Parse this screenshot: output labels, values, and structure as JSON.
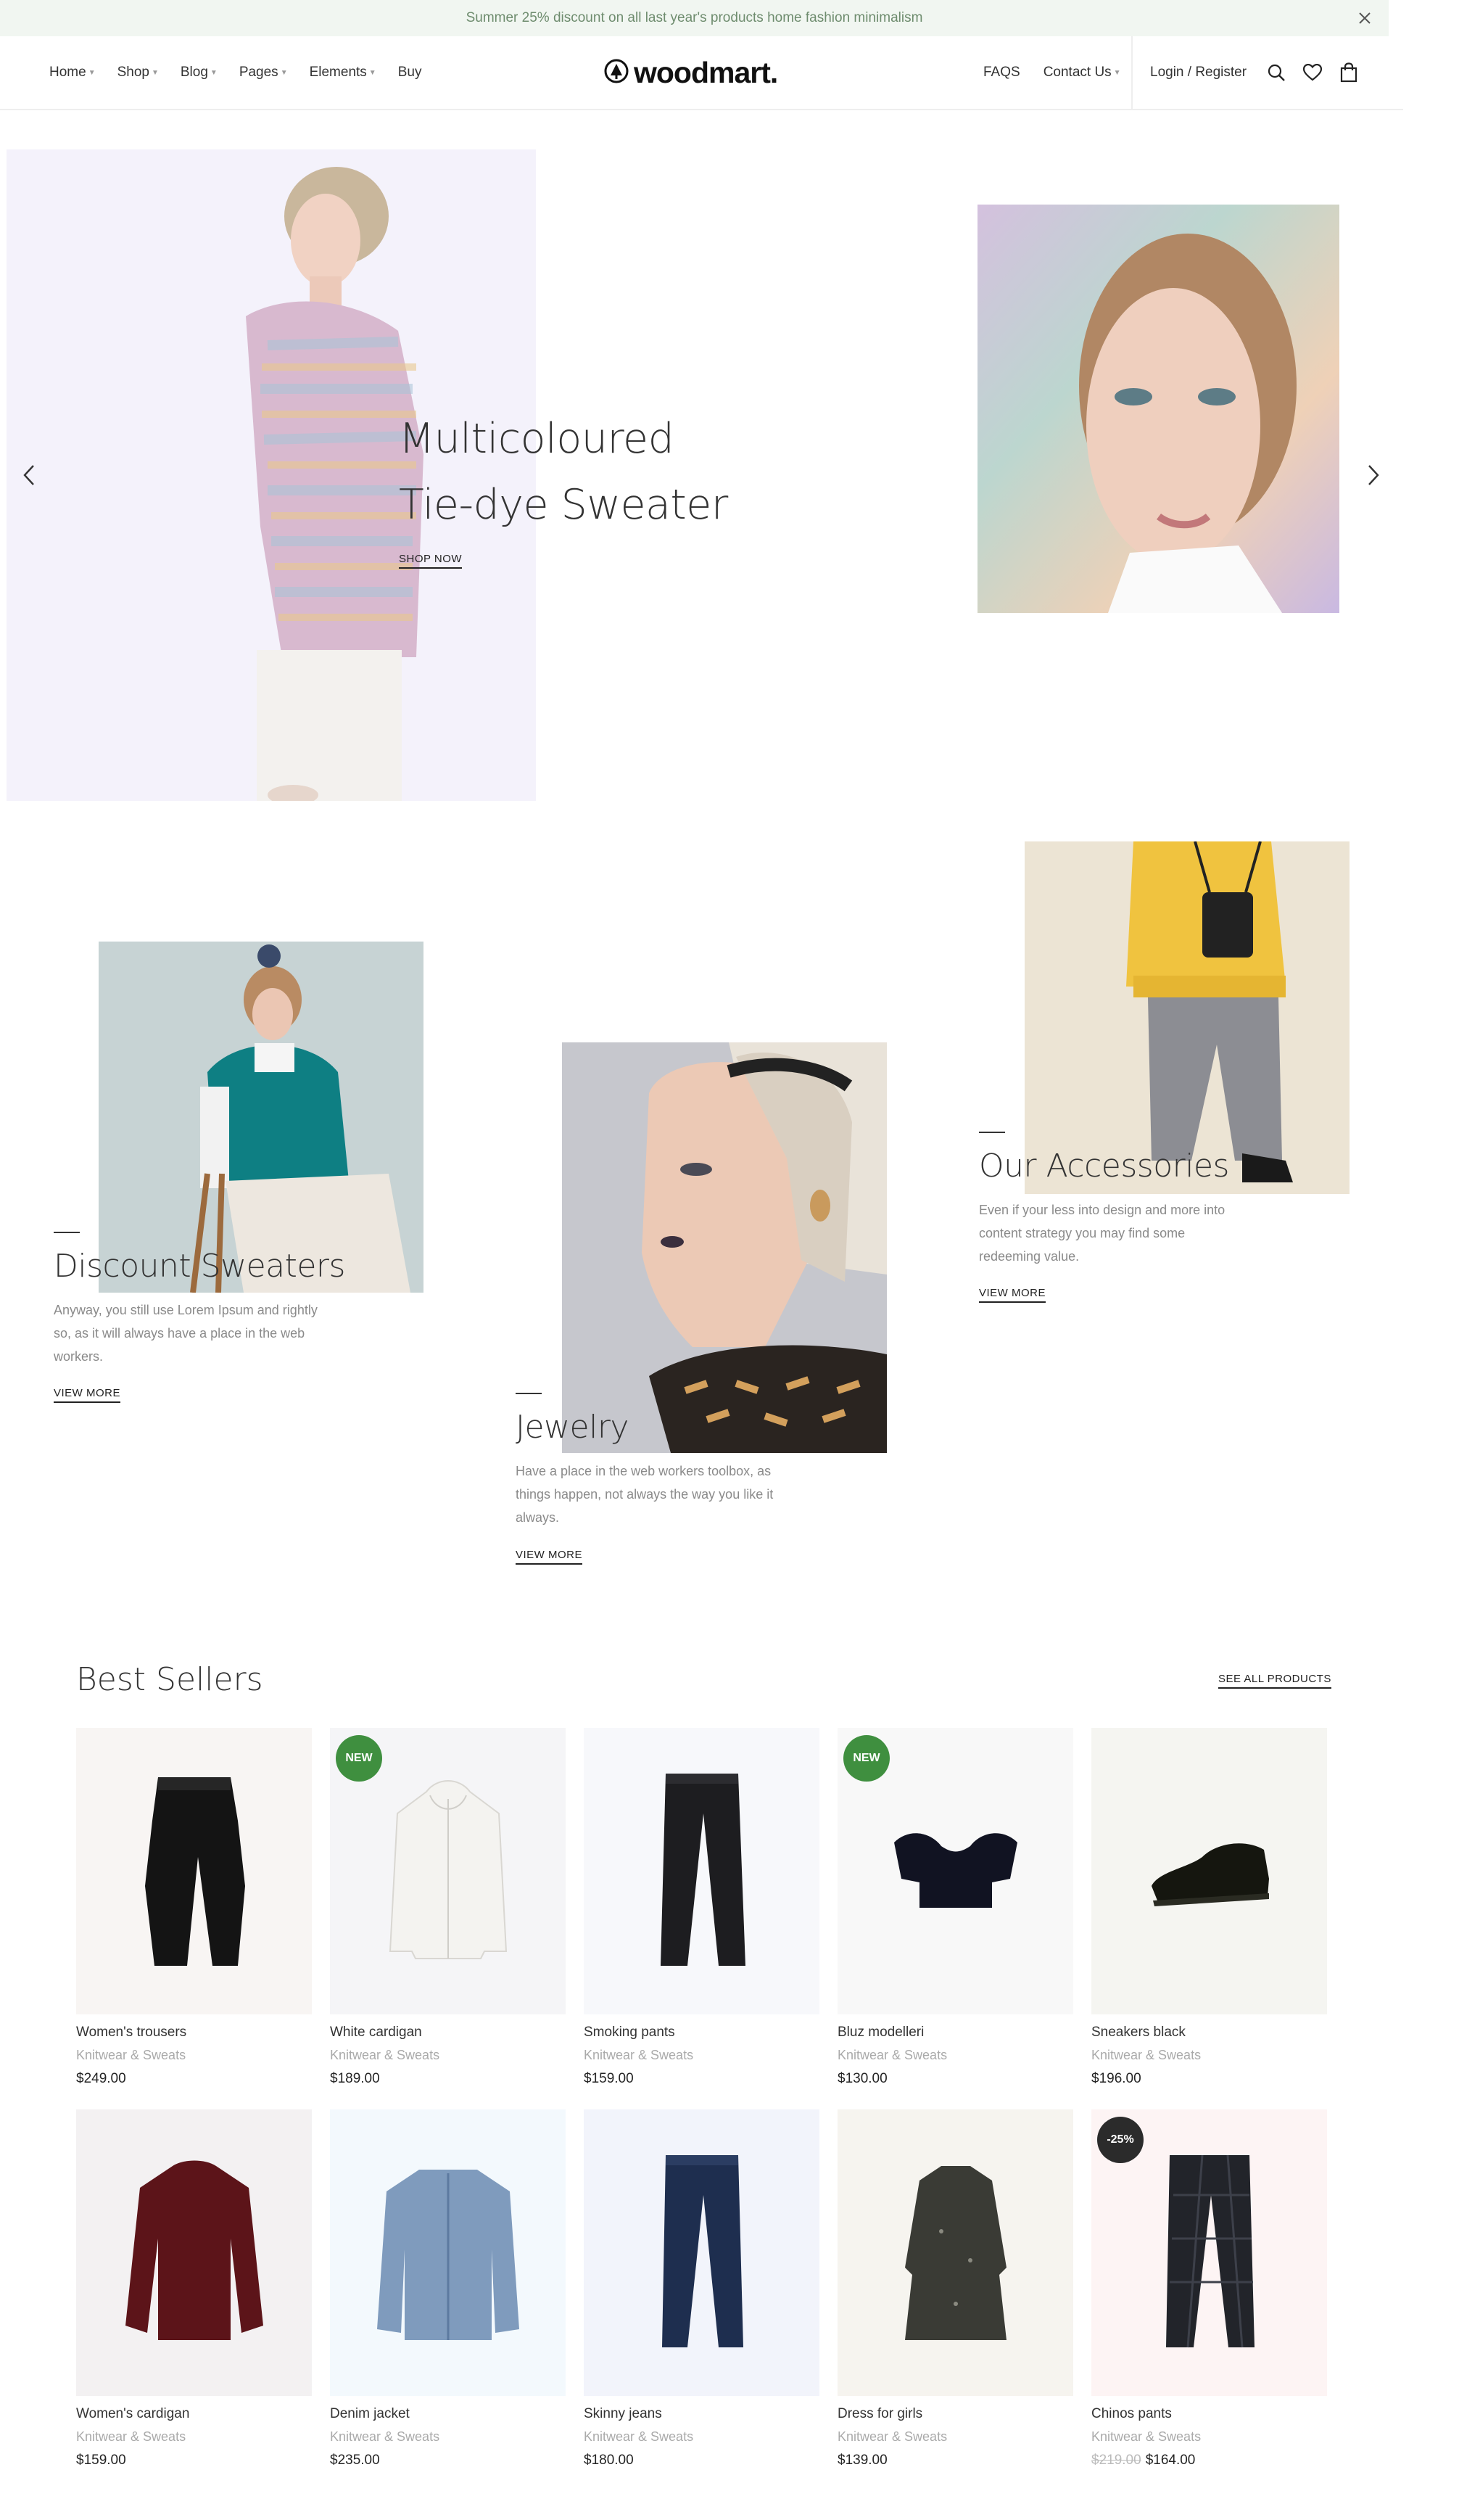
{
  "announcement": {
    "text": "Summer 25% discount on all last year's products home fashion minimalism"
  },
  "header": {
    "nav_left": [
      {
        "label": "Home",
        "has_dropdown": true
      },
      {
        "label": "Shop",
        "has_dropdown": true
      },
      {
        "label": "Blog",
        "has_dropdown": true
      },
      {
        "label": "Pages",
        "has_dropdown": true
      },
      {
        "label": "Elements",
        "has_dropdown": true
      },
      {
        "label": "Buy",
        "has_dropdown": false
      }
    ],
    "logo_text": "woodmart.",
    "nav_right": [
      {
        "label": "FAQS",
        "has_dropdown": false
      },
      {
        "label": "Contact Us",
        "has_dropdown": true
      }
    ],
    "login_label": "Login / Register"
  },
  "hero": {
    "title_line1": "Multicoloured",
    "title_line2": "Tie-dye Sweater",
    "cta": "SHOP NOW"
  },
  "categories": [
    {
      "title": "Discount Sweaters",
      "desc_lines": [
        "Anyway, you still use Lorem Ipsum and rightly",
        "so, as it will always have a place in the web",
        "workers."
      ],
      "link": "VIEW MORE"
    },
    {
      "title": "Jewelry",
      "desc_lines": [
        "Have a place in the web workers toolbox, as",
        "things happen, not always the way you like it",
        "always."
      ],
      "link": "VIEW MORE"
    },
    {
      "title": "Our Accessories",
      "desc_lines": [
        "Even if your less into design and more into",
        "content strategy you may find some",
        "redeeming value."
      ],
      "link": "VIEW MORE"
    }
  ],
  "best_sellers": {
    "title": "Best Sellers",
    "see_all": "SEE ALL PRODUCTS",
    "products": [
      {
        "name": "Women's trousers",
        "category": "Knitwear & Sweats",
        "price": "$249.00",
        "old_price": "",
        "badge": ""
      },
      {
        "name": "White cardigan",
        "category": "Knitwear & Sweats",
        "price": "$189.00",
        "old_price": "",
        "badge": "NEW"
      },
      {
        "name": "Smoking pants",
        "category": "Knitwear & Sweats",
        "price": "$159.00",
        "old_price": "",
        "badge": ""
      },
      {
        "name": "Bluz modelleri",
        "category": "Knitwear & Sweats",
        "price": "$130.00",
        "old_price": "",
        "badge": "NEW"
      },
      {
        "name": "Sneakers black",
        "category": "Knitwear & Sweats",
        "price": "$196.00",
        "old_price": "",
        "badge": ""
      },
      {
        "name": "Women's cardigan",
        "category": "Knitwear & Sweats",
        "price": "$159.00",
        "old_price": "",
        "badge": ""
      },
      {
        "name": "Denim jacket",
        "category": "Knitwear & Sweats",
        "price": "$235.00",
        "old_price": "",
        "badge": ""
      },
      {
        "name": "Skinny jeans",
        "category": "Knitwear & Sweats",
        "price": "$180.00",
        "old_price": "",
        "badge": ""
      },
      {
        "name": "Dress for girls",
        "category": "Knitwear & Sweats",
        "price": "$139.00",
        "old_price": "",
        "badge": ""
      },
      {
        "name": "Chinos pants",
        "category": "Knitwear & Sweats",
        "price": "$164.00",
        "old_price": "$219.00",
        "badge": "-25%"
      }
    ]
  },
  "colors": {
    "announcement_bg": "#f1f6f1",
    "announcement_text": "#6e8c6e",
    "badge_new": "#3f8f3f",
    "badge_sale": "#2b2b2b"
  },
  "icons": [
    "close-icon",
    "logo-tree-icon",
    "search-icon",
    "heart-icon",
    "bag-icon",
    "chevron-left-icon",
    "chevron-right-icon",
    "chevron-down-icon"
  ]
}
